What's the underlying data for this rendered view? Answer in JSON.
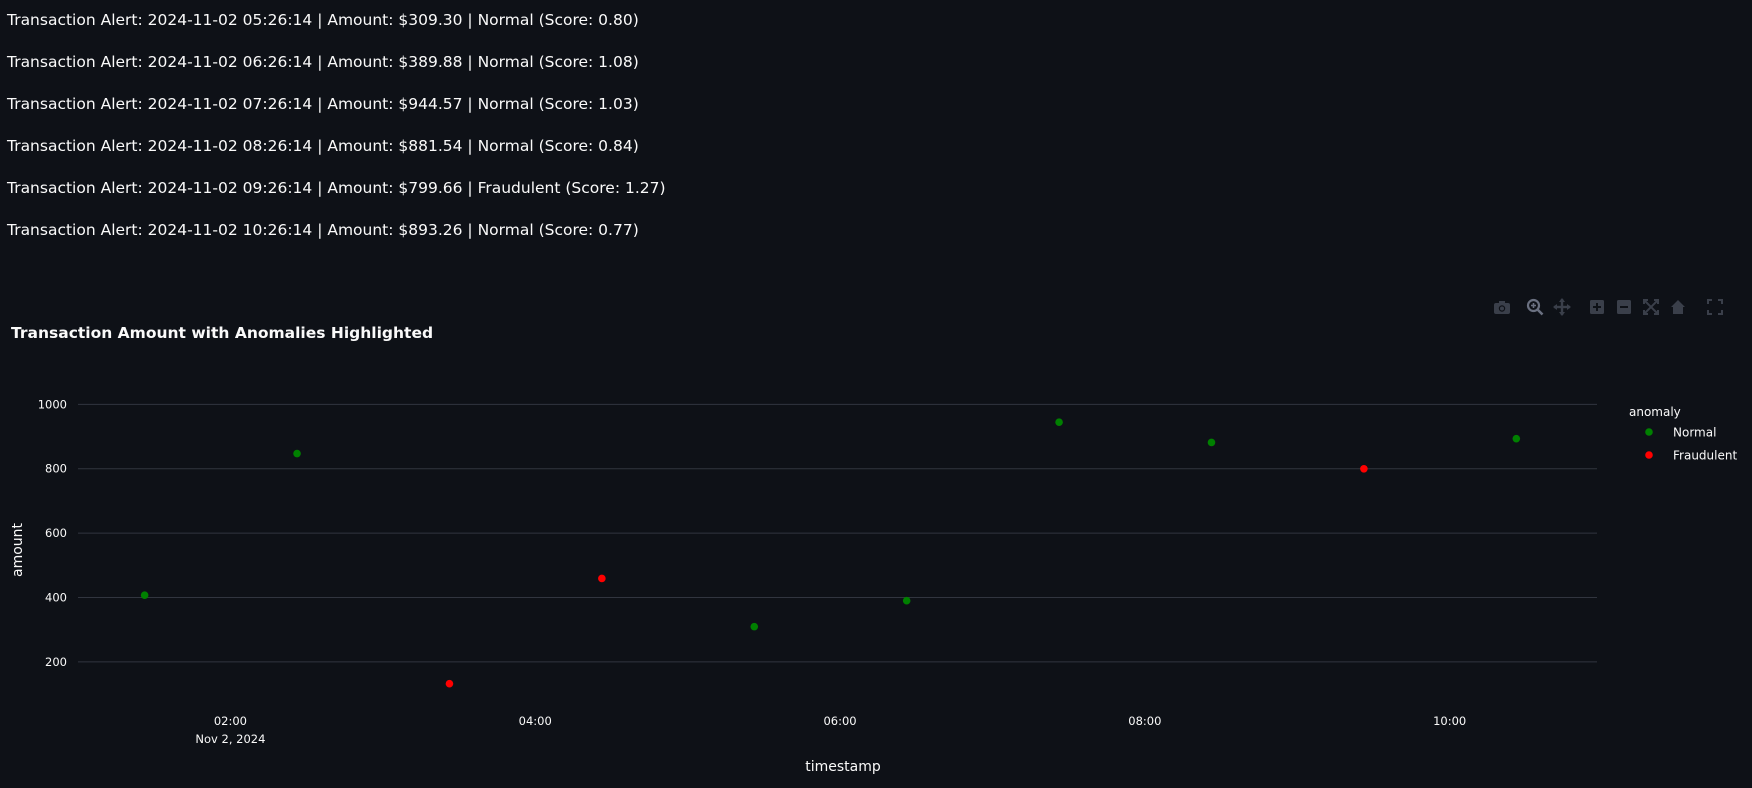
{
  "alerts": [
    "Transaction Alert: 2024-11-02 05:26:14 | Amount: $309.30 | Normal (Score: 0.80)",
    "Transaction Alert: 2024-11-02 06:26:14 | Amount: $389.88 | Normal (Score: 1.08)",
    "Transaction Alert: 2024-11-02 07:26:14 | Amount: $944.57 | Normal (Score: 1.03)",
    "Transaction Alert: 2024-11-02 08:26:14 | Amount: $881.54 | Normal (Score: 0.84)",
    "Transaction Alert: 2024-11-02 09:26:14 | Amount: $799.66 | Fraudulent (Score: 1.27)",
    "Transaction Alert: 2024-11-02 10:26:14 | Amount: $893.26 | Normal (Score: 0.77)"
  ],
  "modebar": {
    "buttons": [
      "camera-icon",
      "zoom-icon",
      "pan-icon",
      "zoom-in-icon",
      "zoom-out-icon",
      "autoscale-icon",
      "home-icon",
      "fullscreen-icon"
    ]
  },
  "chart_data": {
    "type": "scatter",
    "title": "Transaction Amount with Anomalies Highlighted",
    "xlabel": "timestamp",
    "ylabel": "amount",
    "legend_title": "anomaly",
    "legend_position": "right",
    "grid": true,
    "x_ticks": [
      {
        "time": "2024-11-02 02:00",
        "label": "02:00",
        "sublabel": "Nov 2, 2024"
      },
      {
        "time": "2024-11-02 04:00",
        "label": "04:00",
        "sublabel": ""
      },
      {
        "time": "2024-11-02 06:00",
        "label": "06:00",
        "sublabel": ""
      },
      {
        "time": "2024-11-02 08:00",
        "label": "08:00",
        "sublabel": ""
      },
      {
        "time": "2024-11-02 10:00",
        "label": "10:00",
        "sublabel": ""
      }
    ],
    "xlim": [
      "2024-11-02 01:00",
      "2024-11-02 10:58"
    ],
    "ylim": [
      100,
      1060
    ],
    "y_ticks": [
      200,
      400,
      600,
      800,
      1000
    ],
    "series": [
      {
        "name": "Normal",
        "color": "#008000",
        "points": [
          {
            "x": "2024-11-02 01:26:14",
            "y": 407
          },
          {
            "x": "2024-11-02 02:26:14",
            "y": 847
          },
          {
            "x": "2024-11-02 05:26:14",
            "y": 309.3
          },
          {
            "x": "2024-11-02 06:26:14",
            "y": 389.88
          },
          {
            "x": "2024-11-02 07:26:14",
            "y": 944.57
          },
          {
            "x": "2024-11-02 08:26:14",
            "y": 881.54
          },
          {
            "x": "2024-11-02 10:26:14",
            "y": 893.26
          }
        ]
      },
      {
        "name": "Fraudulent",
        "color": "#ff0000",
        "points": [
          {
            "x": "2024-11-02 03:26:14",
            "y": 132
          },
          {
            "x": "2024-11-02 04:26:14",
            "y": 459
          },
          {
            "x": "2024-11-02 09:26:14",
            "y": 799.66
          }
        ]
      }
    ]
  }
}
